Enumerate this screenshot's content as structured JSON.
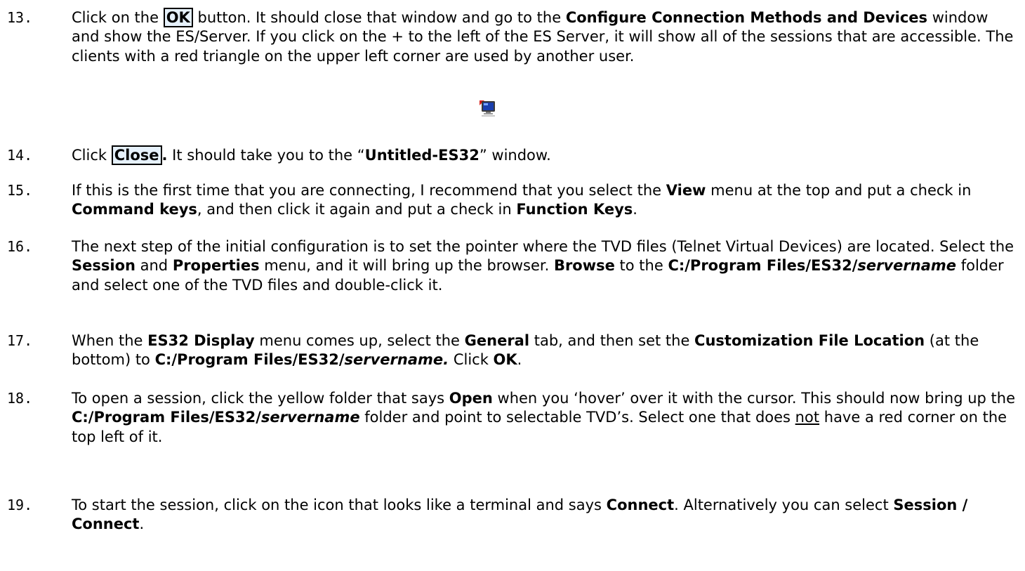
{
  "steps": [
    {
      "num": "13.",
      "t": [
        "Click on the ",
        "OK",
        " button. It should close that window and go to the ",
        "Configure Connection Methods and Devices",
        " window and show the ES/Server.  If you click on the + to the left of the ES Server, it will show all of the sessions that are accessible. The clients with a red triangle on the upper left corner are used by another user."
      ]
    },
    {
      "num": "14.",
      "t": [
        "Click ",
        "Close",
        ".",
        " It should take you to the “",
        "Untitled-ES32",
        "” window."
      ]
    },
    {
      "num": "15.",
      "t": [
        "If this is the first time that you are connecting, I recommend that you select the ",
        "View",
        " menu at the top and put a check in ",
        "Command keys",
        ", and then click it again and put a check in ",
        "Function Keys",
        "."
      ]
    },
    {
      "num": "16.",
      "t": [
        "The next step of the initial configuration is to set the pointer where the TVD files (Telnet Virtual Devices) are located. Select the ",
        "Session",
        " and ",
        "Properties",
        " menu, and it will bring up the browser. ",
        "Browse",
        " to the ",
        "C:/Program Files/ES32/",
        "servername",
        " folder and select one of the TVD files and double-click it."
      ]
    },
    {
      "num": "17.",
      "t": [
        "When the ",
        "ES32 Display",
        " menu comes up, select the ",
        "General",
        " tab, and then set the ",
        "Customization File Location",
        " (at the bottom) to ",
        "C:/Program Files/ES32/",
        "servername.",
        " Click ",
        "OK",
        "."
      ]
    },
    {
      "num": "18.",
      "t": [
        "To open a session, click the yellow folder that says ",
        "Open",
        " when you ‘hover’ over it with the cursor. This should now bring up the ",
        "C:/Program Files/ES32/",
        "servername",
        " folder and point to selectable TVD’s. Select one that does ",
        "not",
        " have a red corner on the top left of it."
      ]
    },
    {
      "num": "19.",
      "t": [
        "To start the session, click on the icon that looks like a terminal and says ",
        "Connect",
        ". Alternatively you can select ",
        "Session / Connect",
        "."
      ]
    }
  ],
  "icons": {
    "terminal": "terminal-in-use-icon"
  },
  "colors": {
    "box_fill": "#e6f1fb",
    "screen": "#1a3fae",
    "alert": "#d91e18"
  }
}
